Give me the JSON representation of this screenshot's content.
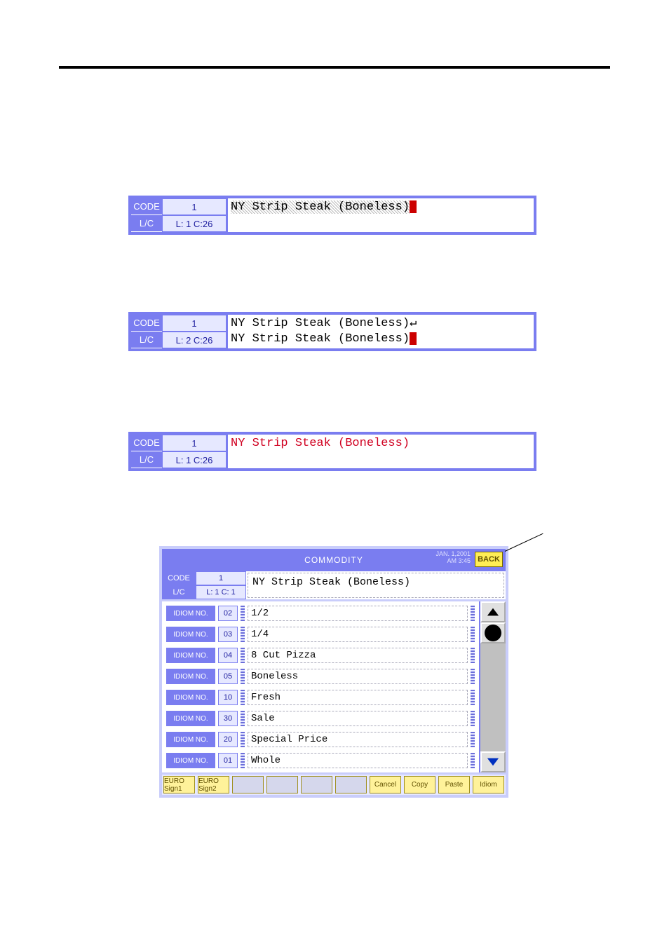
{
  "panel1": {
    "code_label": "CODE",
    "code_value": "1",
    "lc_label": "L/C",
    "lc_value": "L: 1 C:26",
    "text": "NY Strip Steak (Boneless)"
  },
  "panel2": {
    "code_label": "CODE",
    "code_value": "1",
    "lc_label": "L/C",
    "lc_value": "L: 2 C:26",
    "line1": "NY Strip Steak (Boneless)↵",
    "line2": "NY Strip Steak (Boneless)"
  },
  "panel3": {
    "code_label": "CODE",
    "code_value": "1",
    "lc_label": "L/C",
    "lc_value": "L: 1 C:26",
    "text": "NY Strip Steak (Boneless)"
  },
  "win": {
    "title": "COMMODITY",
    "date": "JAN. 1,2001",
    "time": "AM 3:45",
    "back": "BACK",
    "head": {
      "code_label": "CODE",
      "code_value": "1",
      "lc_label": "L/C",
      "lc_value": "L: 1 C: 1",
      "text": "NY Strip Steak (Boneless)"
    },
    "idiom_label": "IDIOM NO.",
    "rows": [
      {
        "no": "02",
        "text": "1/2"
      },
      {
        "no": "03",
        "text": "1/4"
      },
      {
        "no": "04",
        "text": "8 Cut Pizza"
      },
      {
        "no": "05",
        "text": "Boneless"
      },
      {
        "no": "10",
        "text": "Fresh"
      },
      {
        "no": "30",
        "text": "Sale"
      },
      {
        "no": "20",
        "text": "Special Price"
      },
      {
        "no": "01",
        "text": "Whole"
      }
    ],
    "foot": {
      "euro1": "EURO Sign1",
      "euro2": "EURO Sign2",
      "cancel": "Cancel",
      "copy": "Copy",
      "paste": "Paste",
      "idiom": "Idiom"
    }
  }
}
